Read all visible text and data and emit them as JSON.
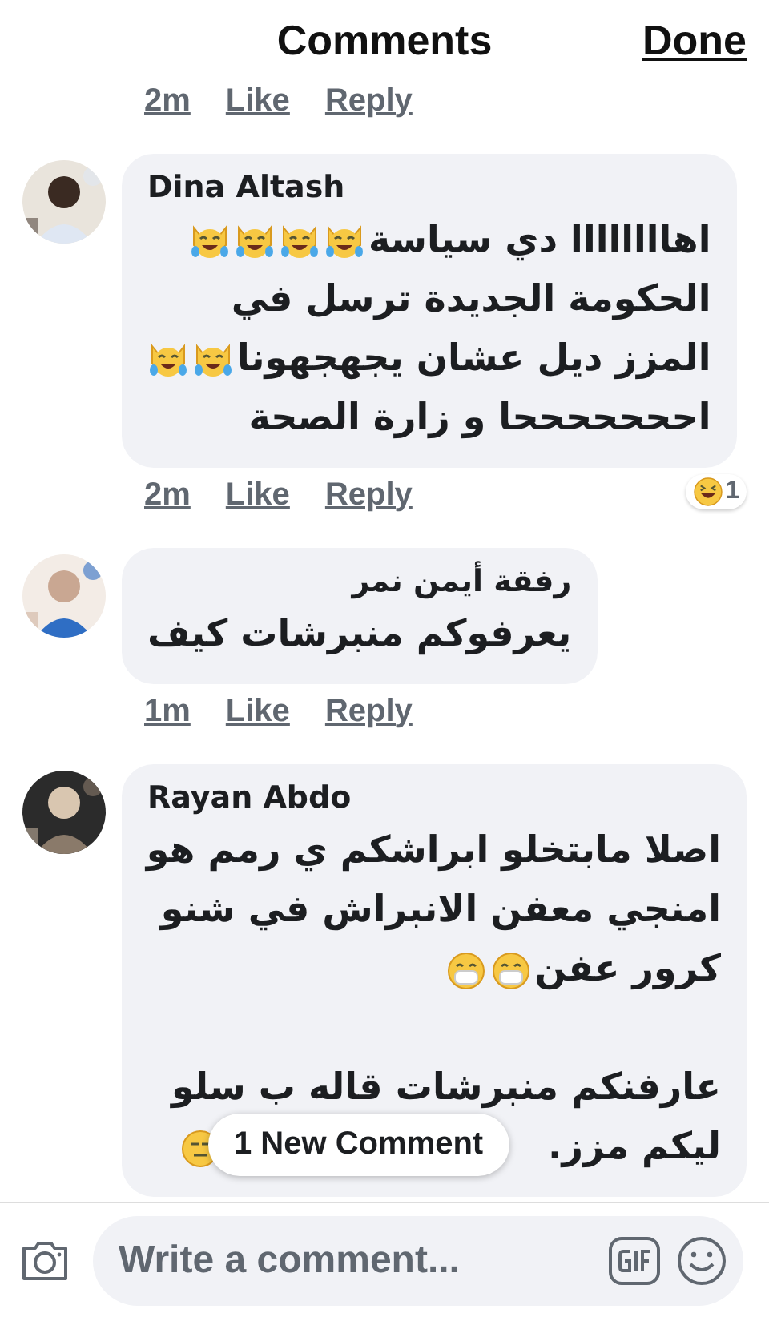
{
  "header": {
    "title": "Comments",
    "done": "Done"
  },
  "previous_meta": {
    "time": "2m",
    "like": "Like",
    "reply": "Reply"
  },
  "comments": [
    {
      "author": "Dina Altash",
      "lines": [
        [
          {
            "kind": "text",
            "text": "اهاااااااا دي سياسة"
          },
          {
            "kind": "cat-laugh"
          },
          {
            "kind": "cat-laugh"
          },
          {
            "kind": "cat-laugh"
          },
          {
            "kind": "cat-laugh"
          }
        ],
        [
          {
            "kind": "text",
            "text": "الحكومة الجديدة ترسل في"
          }
        ],
        [
          {
            "kind": "text",
            "text": "المزز ديل عشان يجهجهونا"
          },
          {
            "kind": "cat-laugh"
          },
          {
            "kind": "cat-laugh"
          }
        ],
        [
          {
            "kind": "text",
            "text": "احححححححا و زارة الصحة"
          }
        ]
      ],
      "time": "2m",
      "like": "Like",
      "reply": "Reply",
      "reaction": {
        "count": "1"
      }
    },
    {
      "author": "رفقة أيمن نمر",
      "lines": [
        [
          {
            "kind": "text",
            "text": "يعرفوكم منبرشات كيف"
          }
        ]
      ],
      "time": "1m",
      "like": "Like",
      "reply": "Reply"
    },
    {
      "author": "Rayan Abdo",
      "lines": [
        [
          {
            "kind": "text",
            "text": "اصلا مابتخلو ابراشكم ي رمم هو"
          }
        ],
        [
          {
            "kind": "text",
            "text": "امنجي معفن الانبراش في شنو"
          }
        ],
        [
          {
            "kind": "text",
            "text": "كرور عفن"
          },
          {
            "kind": "mask"
          },
          {
            "kind": "mask"
          }
        ],
        [
          {
            "kind": "blank"
          }
        ],
        [
          {
            "kind": "text",
            "text": "عارفنكم منبرشات قاله ب سلو"
          }
        ],
        [
          {
            "kind": "text",
            "text": "ليكم مزز."
          },
          {
            "kind": "gap"
          },
          {
            "kind": "expressionless"
          }
        ]
      ]
    }
  ],
  "new_comments": {
    "label": "1 New Comment"
  },
  "composer": {
    "placeholder": "Write a comment..."
  }
}
